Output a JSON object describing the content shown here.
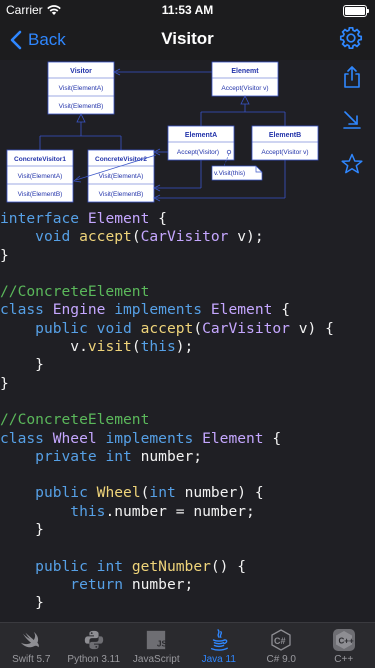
{
  "status": {
    "carrier": "Carrier",
    "time": "11:53 AM"
  },
  "nav": {
    "back_label": "Back",
    "title": "Visitor"
  },
  "diagram": {
    "visitor_title": "Visitor",
    "visitor_methods": [
      "Visit(ElementA)",
      "Visit(ElementB)"
    ],
    "element_title": "Elenemt",
    "element_methods": [
      "Accept(Visitor v)"
    ],
    "concrete1_title": "ConcreteVisitor1",
    "concrete1_methods": [
      "Visit(ElementA)",
      "Visit(ElementB)"
    ],
    "concrete2_title": "ConcreteVisitor2",
    "concrete2_methods": [
      "Visit(ElementA)",
      "Visit(ElementB)"
    ],
    "elementa_title": "ElementA",
    "elementa_methods": [
      "Accept(Visitor)"
    ],
    "elementb_title": "ElementB",
    "elementb_methods": [
      "Accept(Visitor v)"
    ],
    "note": "v.Visit(this)"
  },
  "code_lines": [
    [
      [
        "kw",
        "interface "
      ],
      [
        "tp",
        "Element"
      ],
      [
        "pl",
        " {"
      ]
    ],
    [
      [
        "pl",
        "    "
      ],
      [
        "kw",
        "void "
      ],
      [
        "fn",
        "accept"
      ],
      [
        "pl",
        "("
      ],
      [
        "tp",
        "CarVisitor"
      ],
      [
        "pl",
        " v);"
      ]
    ],
    [
      [
        "pl",
        "}"
      ]
    ],
    [],
    [
      [
        "cm",
        "//ConcreteElement"
      ]
    ],
    [
      [
        "kw",
        "class "
      ],
      [
        "tp",
        "Engine "
      ],
      [
        "kw",
        "implements "
      ],
      [
        "tp",
        "Element"
      ],
      [
        "pl",
        " {"
      ]
    ],
    [
      [
        "pl",
        "    "
      ],
      [
        "kw",
        "public void "
      ],
      [
        "fn",
        "accept"
      ],
      [
        "pl",
        "("
      ],
      [
        "tp",
        "CarVisitor"
      ],
      [
        "pl",
        " v) {"
      ]
    ],
    [
      [
        "pl",
        "        v."
      ],
      [
        "fn",
        "visit"
      ],
      [
        "pl",
        "("
      ],
      [
        "kw",
        "this"
      ],
      [
        "pl",
        ");"
      ]
    ],
    [
      [
        "pl",
        "    }"
      ]
    ],
    [
      [
        "pl",
        "}"
      ]
    ],
    [],
    [
      [
        "cm",
        "//ConcreteElement"
      ]
    ],
    [
      [
        "kw",
        "class "
      ],
      [
        "tp",
        "Wheel "
      ],
      [
        "kw",
        "implements "
      ],
      [
        "tp",
        "Element"
      ],
      [
        "pl",
        " {"
      ]
    ],
    [
      [
        "pl",
        "    "
      ],
      [
        "kw",
        "private int "
      ],
      [
        "pl",
        "number;"
      ]
    ],
    [],
    [
      [
        "pl",
        "    "
      ],
      [
        "kw",
        "public "
      ],
      [
        "fn",
        "Wheel"
      ],
      [
        "pl",
        "("
      ],
      [
        "kw",
        "int "
      ],
      [
        "pl",
        "number) {"
      ]
    ],
    [
      [
        "pl",
        "        "
      ],
      [
        "kw",
        "this"
      ],
      [
        "pl",
        ".number = number;"
      ]
    ],
    [
      [
        "pl",
        "    }"
      ]
    ],
    [],
    [
      [
        "pl",
        "    "
      ],
      [
        "kw",
        "public int "
      ],
      [
        "fn",
        "getNumber"
      ],
      [
        "pl",
        "() {"
      ]
    ],
    [
      [
        "pl",
        "        "
      ],
      [
        "kw",
        "return "
      ],
      [
        "pl",
        "number;"
      ]
    ],
    [
      [
        "pl",
        "    }"
      ]
    ]
  ],
  "tabs": [
    {
      "label": "Swift 5.7",
      "icon": "swift-icon",
      "active": false
    },
    {
      "label": "Python 3.11",
      "icon": "python-icon",
      "active": false
    },
    {
      "label": "JavaScript",
      "icon": "javascript-icon",
      "active": false
    },
    {
      "label": "Java 11",
      "icon": "java-icon",
      "active": true
    },
    {
      "label": "C# 9.0",
      "icon": "csharp-icon",
      "active": false
    },
    {
      "label": "C++",
      "icon": "cpp-icon",
      "active": false
    }
  ],
  "colors": {
    "accent": "#2f87ff",
    "background": "#1f1f24",
    "keyword": "#56a0e6",
    "type": "#c5a7ff",
    "function": "#efd47a",
    "comment": "#5bb85b"
  }
}
